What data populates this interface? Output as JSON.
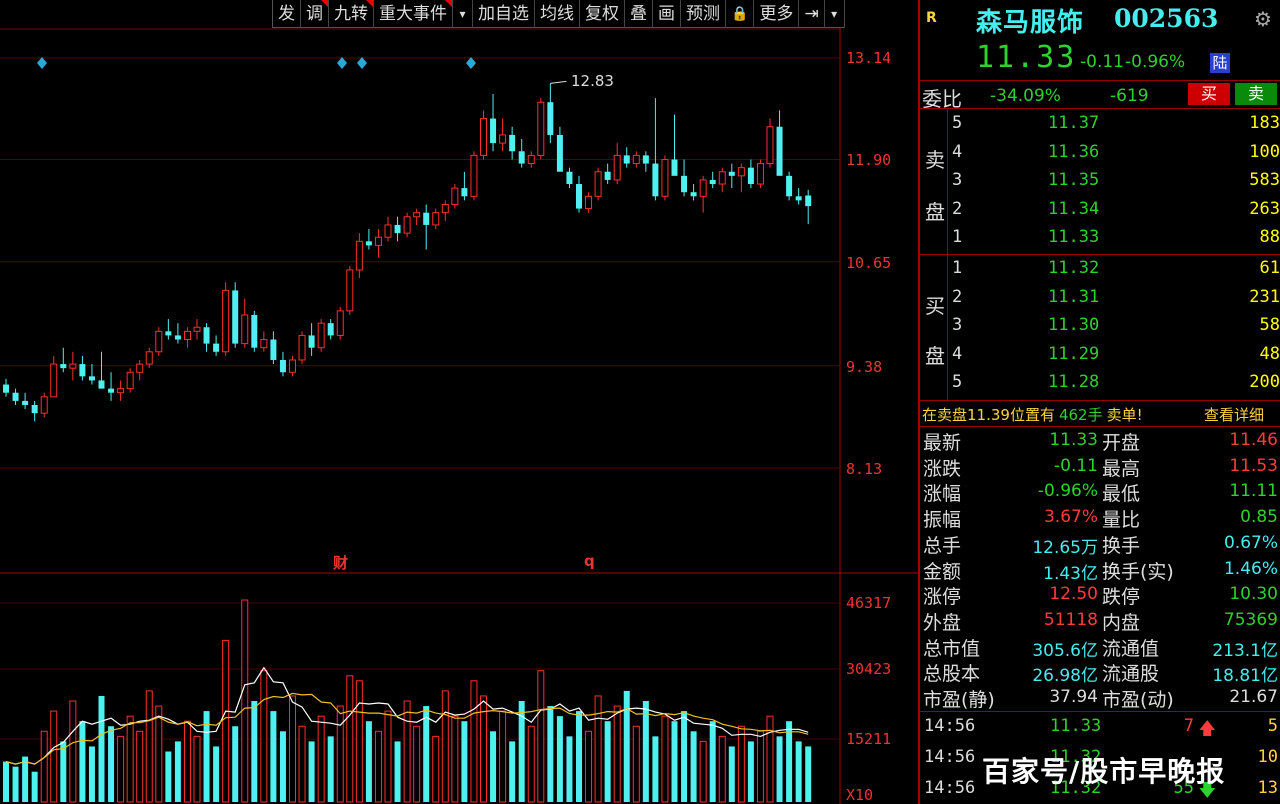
{
  "toolbar": {
    "items": [
      "发",
      "调",
      "九转",
      "重大事件",
      "▾",
      "加自选",
      "均线",
      "复权",
      "叠",
      "画",
      "预测",
      "🔒",
      "更多",
      "⇥",
      "▾"
    ]
  },
  "chart_data": {
    "type": "candlestick",
    "y_ticks": [
      "13.14",
      "11.90",
      "10.65",
      "9.38",
      "8.13"
    ],
    "ylim": [
      7.5,
      13.6
    ],
    "max_label": "12.83",
    "event_marks": [
      "财",
      "q"
    ],
    "volume_ticks": [
      "46317",
      "30423",
      "15211"
    ],
    "volume_unit": "X10",
    "colors": {
      "up": "#ff2d2d",
      "down": "#4ef0f0",
      "ma_fast": "#ffffff",
      "ma_slow": "#f0c020"
    },
    "candles": [
      [
        9.15,
        9.22,
        9.0,
        9.05
      ],
      [
        9.05,
        9.1,
        8.9,
        8.95
      ],
      [
        8.95,
        9.05,
        8.85,
        8.9
      ],
      [
        8.9,
        8.95,
        8.7,
        8.8
      ],
      [
        8.8,
        9.05,
        8.75,
        9.0
      ],
      [
        9.0,
        9.5,
        9.0,
        9.4
      ],
      [
        9.4,
        9.6,
        9.3,
        9.35
      ],
      [
        9.35,
        9.55,
        9.2,
        9.4
      ],
      [
        9.4,
        9.5,
        9.2,
        9.25
      ],
      [
        9.25,
        9.4,
        9.15,
        9.2
      ],
      [
        9.2,
        9.55,
        9.1,
        9.1
      ],
      [
        9.1,
        9.3,
        8.95,
        9.05
      ],
      [
        9.05,
        9.2,
        8.95,
        9.1
      ],
      [
        9.1,
        9.35,
        9.05,
        9.3
      ],
      [
        9.3,
        9.45,
        9.2,
        9.4
      ],
      [
        9.4,
        9.6,
        9.35,
        9.55
      ],
      [
        9.55,
        9.85,
        9.5,
        9.8
      ],
      [
        9.8,
        9.95,
        9.7,
        9.75
      ],
      [
        9.75,
        9.9,
        9.65,
        9.7
      ],
      [
        9.7,
        9.85,
        9.6,
        9.8
      ],
      [
        9.8,
        9.95,
        9.7,
        9.85
      ],
      [
        9.85,
        9.9,
        9.55,
        9.65
      ],
      [
        9.65,
        9.75,
        9.5,
        9.55
      ],
      [
        9.55,
        10.4,
        9.5,
        10.3
      ],
      [
        10.3,
        10.4,
        9.6,
        9.65
      ],
      [
        9.65,
        10.2,
        9.6,
        10.0
      ],
      [
        10.0,
        10.05,
        9.55,
        9.6
      ],
      [
        9.6,
        9.8,
        9.55,
        9.7
      ],
      [
        9.7,
        9.8,
        9.4,
        9.45
      ],
      [
        9.45,
        9.55,
        9.25,
        9.3
      ],
      [
        9.3,
        9.5,
        9.25,
        9.45
      ],
      [
        9.45,
        9.8,
        9.4,
        9.75
      ],
      [
        9.75,
        9.9,
        9.5,
        9.6
      ],
      [
        9.6,
        9.95,
        9.55,
        9.9
      ],
      [
        9.9,
        9.95,
        9.7,
        9.75
      ],
      [
        9.75,
        10.1,
        9.7,
        10.05
      ],
      [
        10.05,
        10.6,
        10.0,
        10.55
      ],
      [
        10.55,
        11.0,
        10.45,
        10.9
      ],
      [
        10.9,
        11.05,
        10.8,
        10.85
      ],
      [
        10.85,
        11.05,
        10.7,
        10.95
      ],
      [
        10.95,
        11.2,
        10.9,
        11.1
      ],
      [
        11.1,
        11.2,
        10.9,
        11.0
      ],
      [
        11.0,
        11.25,
        10.95,
        11.2
      ],
      [
        11.2,
        11.3,
        11.1,
        11.25
      ],
      [
        11.25,
        11.35,
        10.8,
        11.1
      ],
      [
        11.1,
        11.3,
        11.05,
        11.25
      ],
      [
        11.25,
        11.4,
        11.15,
        11.35
      ],
      [
        11.35,
        11.6,
        11.3,
        11.55
      ],
      [
        11.55,
        11.75,
        11.4,
        11.45
      ],
      [
        11.45,
        12.0,
        11.4,
        11.95
      ],
      [
        11.95,
        12.5,
        11.9,
        12.4
      ],
      [
        12.4,
        12.7,
        12.0,
        12.1
      ],
      [
        12.1,
        12.4,
        12.0,
        12.2
      ],
      [
        12.2,
        12.3,
        11.9,
        12.0
      ],
      [
        12.0,
        12.15,
        11.8,
        11.85
      ],
      [
        11.85,
        12.0,
        11.8,
        11.95
      ],
      [
        11.95,
        12.65,
        11.9,
        12.6
      ],
      [
        12.6,
        12.83,
        12.1,
        12.2
      ],
      [
        12.2,
        12.3,
        11.95,
        11.75
      ],
      [
        11.75,
        11.8,
        11.55,
        11.6
      ],
      [
        11.6,
        11.7,
        11.25,
        11.3
      ],
      [
        11.3,
        11.5,
        11.25,
        11.45
      ],
      [
        11.45,
        11.8,
        11.4,
        11.75
      ],
      [
        11.75,
        11.85,
        11.6,
        11.65
      ],
      [
        11.65,
        12.1,
        11.6,
        11.95
      ],
      [
        11.95,
        12.05,
        11.8,
        11.85
      ],
      [
        11.85,
        12.0,
        11.8,
        11.95
      ],
      [
        11.95,
        12.0,
        11.75,
        11.85
      ],
      [
        11.85,
        12.65,
        11.4,
        11.45
      ],
      [
        11.45,
        11.95,
        11.4,
        11.9
      ],
      [
        11.9,
        12.45,
        11.85,
        11.7
      ],
      [
        11.7,
        11.9,
        11.45,
        11.5
      ],
      [
        11.5,
        11.6,
        11.4,
        11.45
      ],
      [
        11.45,
        11.7,
        11.25,
        11.65
      ],
      [
        11.65,
        11.75,
        11.55,
        11.6
      ],
      [
        11.6,
        11.8,
        11.5,
        11.75
      ],
      [
        11.75,
        11.85,
        11.55,
        11.7
      ],
      [
        11.7,
        11.85,
        11.5,
        11.8
      ],
      [
        11.8,
        11.9,
        11.55,
        11.6
      ],
      [
        11.6,
        11.9,
        11.55,
        11.85
      ],
      [
        11.85,
        12.4,
        11.8,
        12.3
      ],
      [
        12.3,
        12.5,
        12.0,
        11.7
      ],
      [
        11.7,
        11.75,
        11.4,
        11.45
      ],
      [
        11.45,
        11.55,
        11.35,
        11.4
      ],
      [
        11.46,
        11.53,
        11.11,
        11.33
      ]
    ],
    "volumes": [
      8,
      7,
      9,
      6,
      14,
      18,
      12,
      20,
      16,
      11,
      21,
      15,
      13,
      17,
      14,
      22,
      19,
      10,
      12,
      16,
      13,
      18,
      11,
      32,
      15,
      40,
      20,
      26,
      18,
      14,
      21,
      15,
      12,
      17,
      13,
      19,
      25,
      24,
      16,
      14,
      18,
      12,
      20,
      15,
      19,
      13,
      22,
      17,
      16,
      24,
      21,
      14,
      18,
      12,
      20,
      15,
      26,
      19,
      17,
      13,
      18,
      14,
      21,
      16,
      19,
      22,
      15,
      20,
      13,
      17,
      16,
      18,
      14,
      12,
      16,
      13,
      11,
      15,
      12,
      14,
      17,
      13,
      16,
      12,
      11
    ]
  },
  "panel": {
    "r_badge": "R",
    "stock_name": "森马服饰",
    "stock_code": "002563",
    "price": "11.33",
    "change": "-0.11",
    "change_pct": "-0.96%",
    "lu_badge": "陆",
    "wei_bi_label": "委比",
    "wei_bi_pct": "-34.09%",
    "wei_cha": "-619",
    "buy_btn": "买",
    "sell_btn": "卖",
    "sell_side_label": [
      "卖",
      "盘"
    ],
    "buy_side_label": [
      "买",
      "盘"
    ],
    "asks": [
      {
        "lvl": "5",
        "price": "11.37",
        "vol": "183"
      },
      {
        "lvl": "4",
        "price": "11.36",
        "vol": "100"
      },
      {
        "lvl": "3",
        "price": "11.35",
        "vol": "583"
      },
      {
        "lvl": "2",
        "price": "11.34",
        "vol": "263"
      },
      {
        "lvl": "1",
        "price": "11.33",
        "vol": "88"
      }
    ],
    "bids": [
      {
        "lvl": "1",
        "price": "11.32",
        "vol": "61"
      },
      {
        "lvl": "2",
        "price": "11.31",
        "vol": "231"
      },
      {
        "lvl": "3",
        "price": "11.30",
        "vol": "58"
      },
      {
        "lvl": "4",
        "price": "11.29",
        "vol": "48"
      },
      {
        "lvl": "5",
        "price": "11.28",
        "vol": "200"
      }
    ],
    "notice_prefix": "在卖盘11.39位置有",
    "notice_qty": "462手",
    "notice_suffix": "卖单!",
    "notice_link": "查看详细",
    "quotes": [
      {
        "l1": "最新",
        "v1": "11.33",
        "c1": "green",
        "l2": "开盘",
        "v2": "11.46",
        "c2": "red"
      },
      {
        "l1": "涨跌",
        "v1": "-0.11",
        "c1": "green",
        "l2": "最高",
        "v2": "11.53",
        "c2": "red"
      },
      {
        "l1": "涨幅",
        "v1": "-0.96%",
        "c1": "green",
        "l2": "最低",
        "v2": "11.11",
        "c2": "green"
      },
      {
        "l1": "振幅",
        "v1": "3.67%",
        "c1": "red",
        "l2": "量比",
        "v2": "0.85",
        "c2": "green"
      },
      {
        "l1": "总手",
        "v1": "12.65万",
        "c1": "cyan",
        "l2": "换手",
        "v2": "0.67%",
        "c2": "cyan"
      },
      {
        "l1": "金额",
        "v1": "1.43亿",
        "c1": "cyan",
        "l2": "换手(实)",
        "v2": "1.46%",
        "c2": "cyan"
      },
      {
        "l1": "涨停",
        "v1": "12.50",
        "c1": "red",
        "l2": "跌停",
        "v2": "10.30",
        "c2": "green"
      },
      {
        "l1": "外盘",
        "v1": "51118",
        "c1": "red",
        "l2": "内盘",
        "v2": "75369",
        "c2": "green"
      },
      {
        "l1": "总市值",
        "v1": "305.6亿",
        "c1": "cyan",
        "l2": "流通值",
        "v2": "213.1亿",
        "c2": "cyan"
      },
      {
        "l1": "总股本",
        "v1": "26.98亿",
        "c1": "cyan",
        "l2": "流通股",
        "v2": "18.81亿",
        "c2": "cyan"
      },
      {
        "l1": "市盈(静)",
        "v1": "37.94",
        "c1": "white",
        "l2": "市盈(动)",
        "v2": "21.67",
        "c2": "white"
      }
    ],
    "ticks": [
      {
        "time": "14:56",
        "price": "11.33",
        "vol": "7",
        "dir": "up",
        "cnt": "5"
      },
      {
        "time": "14:56",
        "price": "11.32",
        "vol": "",
        "dir": "",
        "cnt": "10"
      },
      {
        "time": "14:56",
        "price": "11.32",
        "vol": "55",
        "dir": "down",
        "cnt": "13"
      }
    ]
  },
  "watermark": "百家号/股市早晚报"
}
